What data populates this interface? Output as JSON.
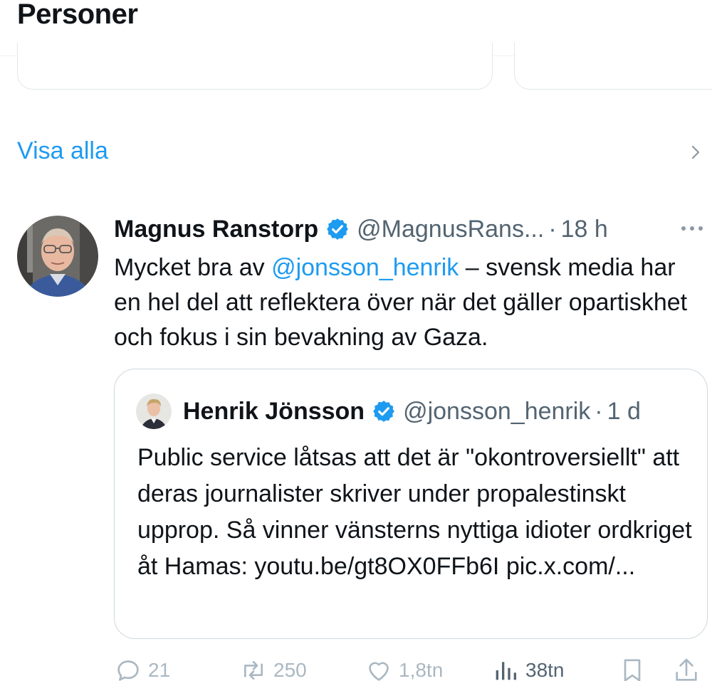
{
  "section": {
    "title": "Personer"
  },
  "show_all": {
    "label": "Visa alla"
  },
  "tweet": {
    "author_name": "Magnus Ranstorp",
    "handle": "@MagnusRans...",
    "separator": "·",
    "time": "18 h",
    "text_before": "Mycket bra av ",
    "mention": "@jonsson_henrik",
    "text_after": " – svensk media har en hel del att reflektera över när det gäller opartiskhet och fokus i sin bevakning av Gaza."
  },
  "quote": {
    "author_name": "Henrik Jönsson",
    "handle": "@jonsson_henrik",
    "separator": "·",
    "time": "1 d",
    "text": "Public service låtsas att det är \"okontroversiellt\" att deras journalister skriver under propalestinskt upprop. Så vinner vänsterns nyttiga idioter ordkriget åt Hamas: youtu.be/gt8OX0FFb6I pic.x.com/..."
  },
  "actions": {
    "replies": "21",
    "reposts": "250",
    "likes": "1,8tn",
    "views": "38tn"
  },
  "colors": {
    "accent": "#1d9bf0",
    "text": "#0f1419",
    "secondary": "#536471"
  },
  "icons": [
    "chevron-right-icon",
    "verified-badge-icon",
    "more-icon",
    "reply-icon",
    "repost-icon",
    "like-icon",
    "views-icon",
    "bookmark-icon",
    "share-icon"
  ]
}
